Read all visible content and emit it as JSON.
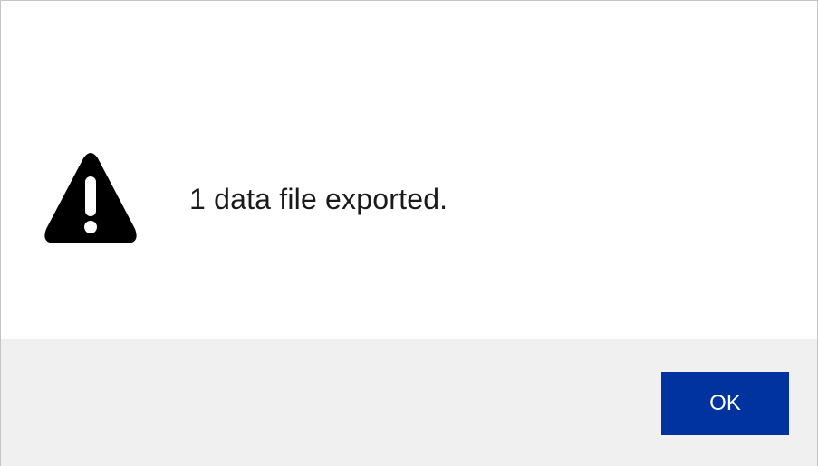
{
  "dialog": {
    "icon": "warning-icon",
    "message": "1 data file exported.",
    "ok_label": "OK",
    "colors": {
      "button": "#0033a0",
      "footer": "#f0f0f0",
      "icon": "#000000"
    }
  }
}
